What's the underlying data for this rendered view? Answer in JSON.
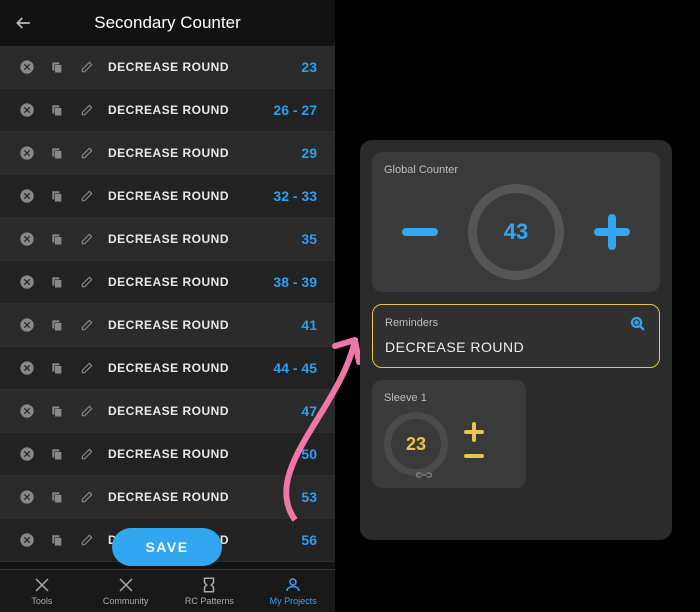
{
  "header": {
    "title": "Secondary Counter"
  },
  "rows": [
    {
      "label": "DECREASE ROUND",
      "value": "23"
    },
    {
      "label": "DECREASE ROUND",
      "value": "26 - 27"
    },
    {
      "label": "DECREASE ROUND",
      "value": "29"
    },
    {
      "label": "DECREASE ROUND",
      "value": "32 - 33"
    },
    {
      "label": "DECREASE ROUND",
      "value": "35"
    },
    {
      "label": "DECREASE ROUND",
      "value": "38 - 39"
    },
    {
      "label": "DECREASE ROUND",
      "value": "41"
    },
    {
      "label": "DECREASE ROUND",
      "value": "44 - 45"
    },
    {
      "label": "DECREASE ROUND",
      "value": "47"
    },
    {
      "label": "DECREASE ROUND",
      "value": "50"
    },
    {
      "label": "DECREASE ROUND",
      "value": "53"
    },
    {
      "label": "DECREASE ROUND",
      "value": "56"
    }
  ],
  "save_label": "SAVE",
  "tabs": [
    {
      "label": "Tools"
    },
    {
      "label": "Community"
    },
    {
      "label": "RC Patterns"
    },
    {
      "label": "My Projects"
    }
  ],
  "global_counter": {
    "title": "Global Counter",
    "value": "43"
  },
  "reminders": {
    "title": "Reminders",
    "text": "DECREASE ROUND"
  },
  "sleeve": {
    "title": "Sleeve 1",
    "value": "23"
  }
}
